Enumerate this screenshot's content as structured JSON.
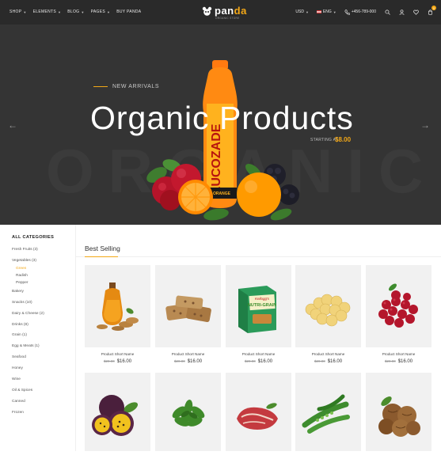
{
  "header": {
    "nav": [
      {
        "label": "SHOP",
        "has_dropdown": true
      },
      {
        "label": "ELEMENTS",
        "has_dropdown": true
      },
      {
        "label": "BLOG",
        "has_dropdown": true
      },
      {
        "label": "PAGES",
        "has_dropdown": true
      },
      {
        "label": "BUY PANDA",
        "has_dropdown": false
      }
    ],
    "logo": {
      "text_main": "pan",
      "text_accent": "da",
      "tagline": "ORGANIC STORE"
    },
    "currency": "USD",
    "language": "ENG",
    "phone": "+456-789-000",
    "cart_count": "0",
    "icons": [
      "search-icon",
      "user-icon",
      "heart-icon",
      "cart-icon",
      "phone-icon",
      "flag-icon"
    ]
  },
  "hero": {
    "eyebrow": "NEW ARRIVALS",
    "title": "Organic Products",
    "starting_label": "STARTING AT",
    "price": "$8.00",
    "background_word": "ORGANIC",
    "colors": {
      "bg": "#343434",
      "accent": "#f3a817"
    }
  },
  "sidebar": {
    "heading": "ALL CATEGORIES",
    "items": [
      {
        "label": "Fresh Fruits (3)",
        "level": 0
      },
      {
        "label": "Vegetables (3)",
        "level": 0
      },
      {
        "label": "Green",
        "level": 1,
        "active": true
      },
      {
        "label": "Radish",
        "level": 1
      },
      {
        "label": "Pepper",
        "level": 1
      },
      {
        "label": "Bakery",
        "level": 0
      },
      {
        "label": "Snacks (10)",
        "level": 0
      },
      {
        "label": "Dairy & Cheese (2)",
        "level": 0
      },
      {
        "label": "Drinks (8)",
        "level": 0
      },
      {
        "label": "Grain (1)",
        "level": 0
      },
      {
        "label": "Egg & Meats (1)",
        "level": 0
      },
      {
        "label": "Seafood",
        "level": 0
      },
      {
        "label": "Honey",
        "level": 0
      },
      {
        "label": "Wine",
        "level": 0
      },
      {
        "label": "Oil & Spices",
        "level": 0
      },
      {
        "label": "Canned",
        "level": 0
      },
      {
        "label": "Frozen",
        "level": 0
      }
    ]
  },
  "best_selling": {
    "title": "Best Selling",
    "products": [
      {
        "name": "Product Short Name",
        "old_price": "$20.00",
        "price": "$16.00",
        "image": "honey-jar"
      },
      {
        "name": "Product Short Name",
        "old_price": "$20.00",
        "price": "$16.00",
        "image": "granola-bars"
      },
      {
        "name": "Product Short Name",
        "old_price": "$20.00",
        "price": "$16.00",
        "image": "cereal-box"
      },
      {
        "name": "Product Short Name",
        "old_price": "$20.00",
        "price": "$16.00",
        "image": "banana-chips"
      },
      {
        "name": "Product Short Name",
        "old_price": "$20.00",
        "price": "$16.00",
        "image": "cranberries"
      },
      {
        "name": "",
        "old_price": "",
        "price": "",
        "image": "passion-fruit"
      },
      {
        "name": "",
        "old_price": "",
        "price": "",
        "image": "arugula"
      },
      {
        "name": "",
        "old_price": "",
        "price": "",
        "image": "raw-meat"
      },
      {
        "name": "",
        "old_price": "",
        "price": "",
        "image": "green-peas"
      },
      {
        "name": "",
        "old_price": "",
        "price": "",
        "image": "walnuts"
      }
    ],
    "product_box_text": {
      "brand": "Kellogg's",
      "title": "NUTRI-GRAIN"
    }
  }
}
